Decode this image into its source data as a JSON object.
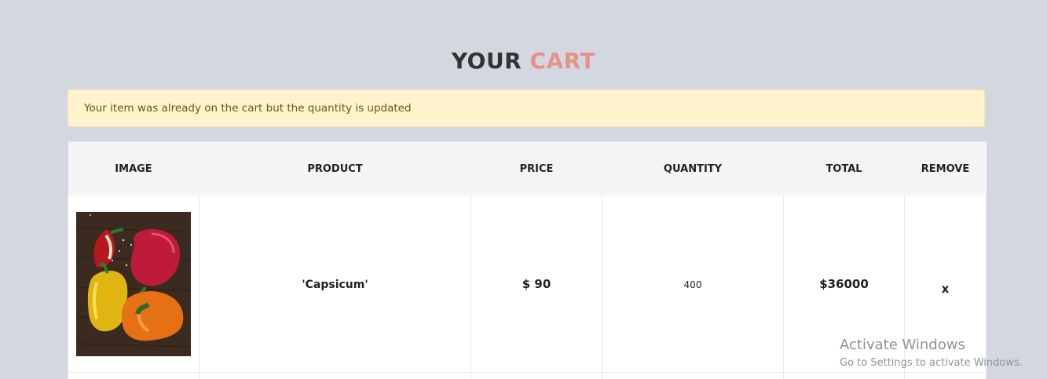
{
  "header": {
    "title_word1": "YOUR",
    "title_word2": "CART"
  },
  "alert": {
    "message": "Your item was already on the cart but the quantity is updated"
  },
  "table": {
    "columns": [
      "IMAGE",
      "PRODUCT",
      "PRICE",
      "QUANTITY",
      "TOTAL",
      "REMOVE"
    ],
    "rows": [
      {
        "image": "bell-peppers-image",
        "product": "'Capsicum'",
        "price": "$ 90",
        "quantity": "400",
        "total": "$36000",
        "remove": "x"
      }
    ]
  },
  "watermark": {
    "line1": "Activate Windows",
    "line2": "Go to Settings to activate Windows."
  },
  "colors": {
    "background": "#d3d7e0",
    "title_accent": "#e8918a",
    "alert_bg": "#fff3cd",
    "alert_text": "#6b5513"
  }
}
